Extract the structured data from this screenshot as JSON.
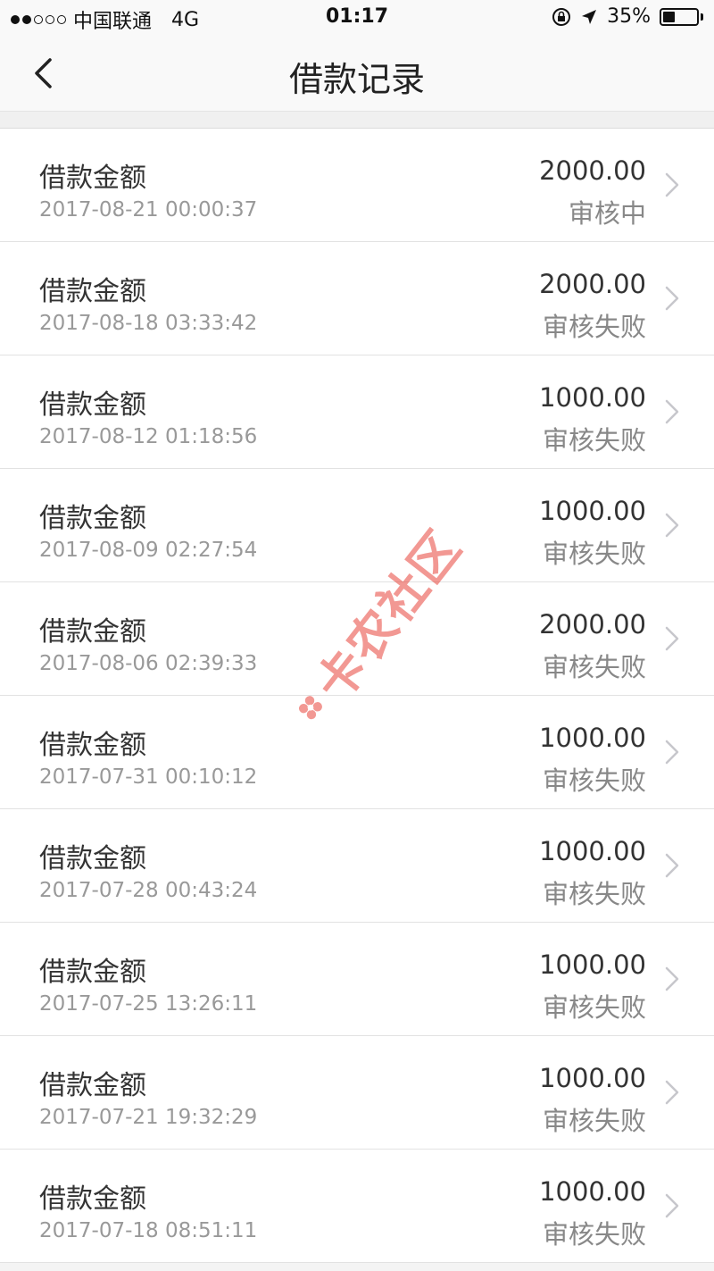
{
  "status_bar": {
    "carrier": "中国联通",
    "network": "4G",
    "time": "01:17",
    "battery_percent_label": "35%",
    "battery_level": 0.35,
    "signal_strength": 2
  },
  "nav": {
    "title": "借款记录",
    "back_icon": "chevron-left-icon"
  },
  "records": [
    {
      "label": "借款金额",
      "time": "2017-08-21 00:00:37",
      "amount": "2000.00",
      "status": "审核中"
    },
    {
      "label": "借款金额",
      "time": "2017-08-18 03:33:42",
      "amount": "2000.00",
      "status": "审核失败"
    },
    {
      "label": "借款金额",
      "time": "2017-08-12 01:18:56",
      "amount": "1000.00",
      "status": "审核失败"
    },
    {
      "label": "借款金额",
      "time": "2017-08-09 02:27:54",
      "amount": "1000.00",
      "status": "审核失败"
    },
    {
      "label": "借款金额",
      "time": "2017-08-06 02:39:33",
      "amount": "2000.00",
      "status": "审核失败"
    },
    {
      "label": "借款金额",
      "time": "2017-07-31 00:10:12",
      "amount": "1000.00",
      "status": "审核失败"
    },
    {
      "label": "借款金额",
      "time": "2017-07-28 00:43:24",
      "amount": "1000.00",
      "status": "审核失败"
    },
    {
      "label": "借款金额",
      "time": "2017-07-25 13:26:11",
      "amount": "1000.00",
      "status": "审核失败"
    },
    {
      "label": "借款金额",
      "time": "2017-07-21 19:32:29",
      "amount": "1000.00",
      "status": "审核失败"
    },
    {
      "label": "借款金额",
      "time": "2017-07-18 08:51:11",
      "amount": "1000.00",
      "status": "审核失败"
    }
  ],
  "watermark": {
    "text": "卡农社区",
    "color": "#e8453c"
  },
  "colors": {
    "background": "#f4f4f4",
    "row_background": "#ffffff",
    "secondary_text": "#999999"
  }
}
